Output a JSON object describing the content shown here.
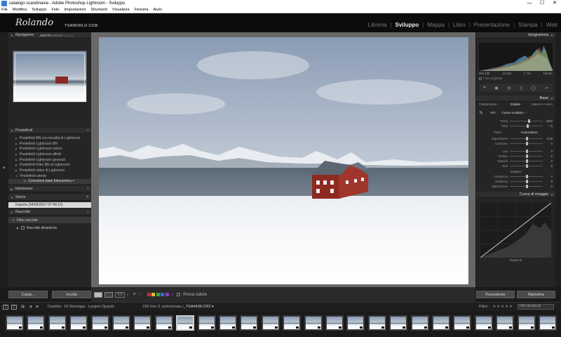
{
  "window": {
    "title": "catalogo scandinavia - Adobe Photoshop Lightroom - Sviluppo",
    "controls": [
      "—",
      "☐",
      "✕"
    ]
  },
  "menu": [
    "File",
    "Modifica",
    "Sviluppo",
    "Foto",
    "Impostazioni",
    "Strumenti",
    "Visualizza",
    "Finestra",
    "Aiuto"
  ],
  "identity": {
    "signature": "Rolando",
    "site": "YSAWORLD.COM"
  },
  "modules": [
    {
      "label": "Libreria",
      "active": false
    },
    {
      "label": "Sviluppo",
      "active": true
    },
    {
      "label": "Mappa",
      "active": false
    },
    {
      "label": "Libro",
      "active": false
    },
    {
      "label": "Presentazione",
      "active": false
    },
    {
      "label": "Stampa",
      "active": false
    },
    {
      "label": "Web",
      "active": false
    }
  ],
  "left": {
    "navigator": {
      "title": "Navigatore",
      "opt1": "ADATTA",
      "opt2": "RIEMPI",
      "opt3": "1:1",
      "opt4": "2:1"
    },
    "presets": {
      "title": "Predefiniti",
      "items": [
        "Predefiniti BN con tonalità di Lightroom",
        "Predefiniti Lightroom BN",
        "Predefiniti Lightroom colore",
        "Predefiniti Lightroom effetti",
        "Predefiniti Lightroom generali",
        "Predefiniti Filtro BN di Lightroom",
        "Predefiniti video di Lightroom",
        "Predefiniti utente"
      ],
      "subitem": "Correzioni base fotocamera +"
    },
    "snapshots": {
      "title": "Istantanee"
    },
    "history": {
      "title": "Storia",
      "item": "Importa (04/02/2017 07:49:12)"
    },
    "collections": {
      "title": "Raccolte",
      "filter": "Filtra raccolte",
      "smart": "Raccolte dinamiche"
    },
    "copy_label": "Copia...",
    "paste_label": "Incolla"
  },
  "toolbar": {
    "yy_label": "Y|Y",
    "soft_proof": "Prova colore",
    "swatch_colors": [
      "#d03030",
      "#d8c030",
      "#40a040",
      "#3070d0",
      "#9040c0"
    ]
  },
  "right": {
    "histogram": {
      "title": "Istogramma",
      "iso": "ISO 100",
      "focal": "12 mm",
      "aperture": "f / 14",
      "shutter": "1/8 sec",
      "original": "Foto originale"
    },
    "basic": {
      "title": "Base",
      "treatment_label": "Trattamento :",
      "color_label": "Colore",
      "bw_label": "Bianco e nero",
      "wb_label": "WB :",
      "wb_value": "Come scattato ÷",
      "sliders_wb": [
        {
          "label": "Temp",
          "value": "4600"
        },
        {
          "label": "Tinta",
          "value": "+ 5"
        }
      ],
      "tone_label": "Tono",
      "auto_label": "Automatico",
      "sliders_tone": [
        {
          "label": "Esposizione",
          "value": "0,00"
        },
        {
          "label": "Contrasto",
          "value": "0"
        },
        {
          "label": "Luci",
          "value": "0"
        },
        {
          "label": "Ombre",
          "value": "0"
        },
        {
          "label": "Bianchi",
          "value": "0"
        },
        {
          "label": "Neri",
          "value": "0"
        }
      ],
      "presence_label": "Impatto",
      "sliders_presence": [
        {
          "label": "Chiarezza",
          "value": "0"
        },
        {
          "label": "Vividezza",
          "value": "0"
        },
        {
          "label": "Saturazione",
          "value": "0"
        }
      ]
    },
    "curve": {
      "title": "Curva di viraggio",
      "region": "Regione"
    },
    "prev_label": "Precedente",
    "reset_label": "Ripristina"
  },
  "filmstrip_bar": {
    "page1": "1",
    "page2": "2",
    "path": "Cartella : 15 Norvegia - Lyngen Djupvik",
    "count": "226 foto /1 selezionata /",
    "filename": "_YSA4436.CR2 ▾",
    "filter_label": "Filtro :",
    "stars": "★★★★★",
    "filter_value": "Filtri disattivati"
  },
  "filmstrip": {
    "count": 26,
    "selected": 8
  }
}
